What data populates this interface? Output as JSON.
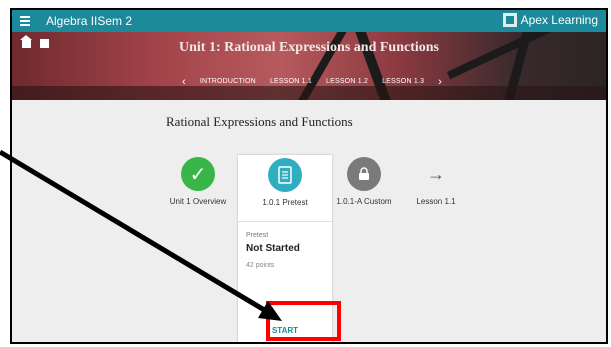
{
  "header": {
    "course_title": "Algebra IISem 2",
    "brand": "Apex Learning"
  },
  "banner": {
    "unit_title": "Unit 1: Rational Expressions and Functions",
    "breadcrumbs": [
      "INTRODUCTION",
      "LESSON 1.1",
      "LESSON 1.2",
      "LESSON 1.3"
    ]
  },
  "main": {
    "section_title": "Rational Expressions and Functions",
    "steps": [
      {
        "label": "Unit 1 Overview",
        "icon": "check-icon"
      },
      {
        "label": "1.0.1 Pretest",
        "icon": "document-icon"
      },
      {
        "label": "1.0.1-A Custom",
        "icon": "lock-icon"
      },
      {
        "label": "Lesson 1.1",
        "icon": "arrow-right-icon"
      }
    ],
    "card": {
      "type": "Pretest",
      "status": "Not Started",
      "points": "42 points",
      "action": "START"
    }
  },
  "colors": {
    "topbar": "#1c8a9a",
    "highlight": "#ff0000",
    "complete": "#39b54a",
    "current": "#2eaec0",
    "locked": "#7a7a7a"
  }
}
